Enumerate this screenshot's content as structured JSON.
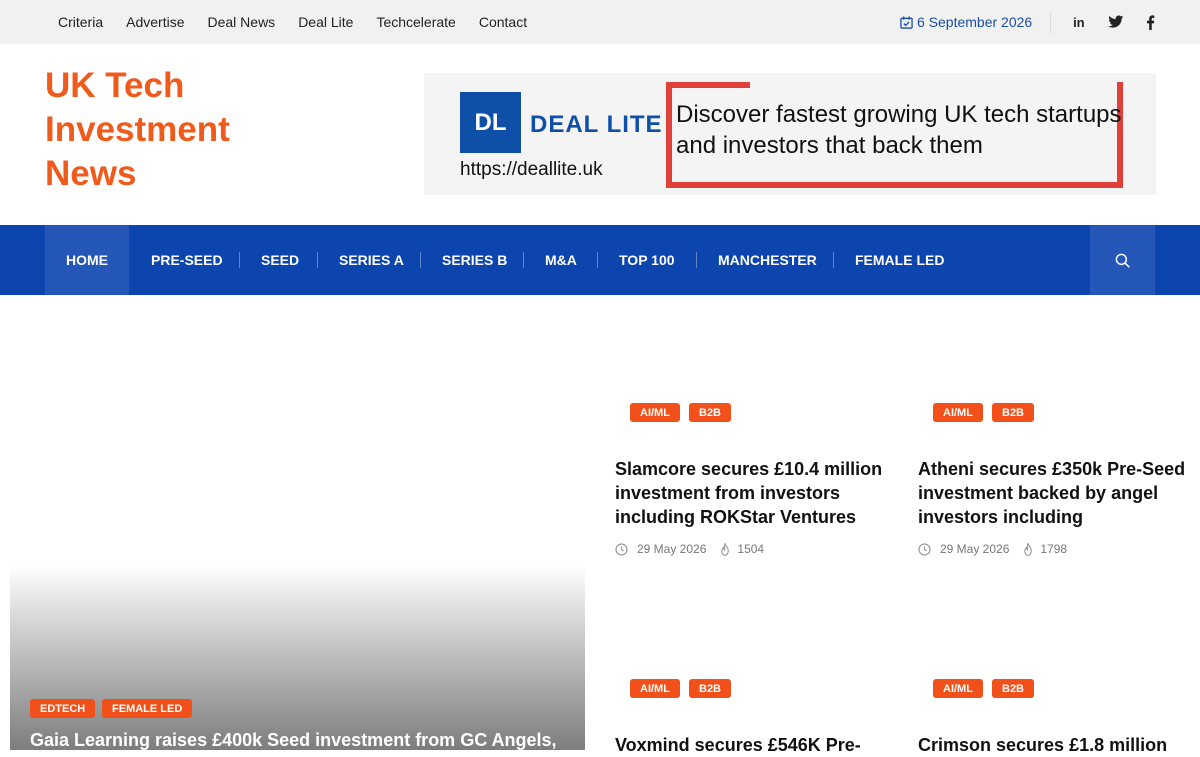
{
  "top_nav": {
    "items": [
      "Criteria",
      "Advertise",
      "Deal News",
      "Deal Lite",
      "Techcelerate",
      "Contact"
    ],
    "date": "6 September 2026",
    "social_icons": [
      "linkedin-icon",
      "twitter-icon",
      "facebook-icon"
    ]
  },
  "site": {
    "title": "UK Tech Investment News"
  },
  "banner": {
    "logo_mark": "DL",
    "logo_name": "DEAL LITE",
    "url": "https://deallite.uk",
    "tagline": "Discover fastest growing UK tech startups and investors that back them"
  },
  "main_nav": {
    "items": [
      "HOME",
      "PRE-SEED",
      "SEED",
      "SERIES A",
      "SERIES B",
      "M&A",
      "TOP 100",
      "MANCHESTER",
      "FEMALE LED"
    ],
    "active": "HOME"
  },
  "featured": {
    "tags": [
      "EDTECH",
      "FEMALE LED"
    ],
    "title": "Gaia Learning raises £400k Seed investment from GC Angels,"
  },
  "articles": [
    {
      "tags": [
        "AI/ML",
        "B2B"
      ],
      "title": "Slamcore secures £10.4 million investment from investors including ROKStar Ventures",
      "date": "29 May 2026",
      "views": "1504"
    },
    {
      "tags": [
        "AI/ML",
        "B2B"
      ],
      "title": "Atheni secures £350k Pre-Seed investment backed by angel investors including",
      "date": "29 May 2026",
      "views": "1798"
    },
    {
      "tags": [
        "AI/ML",
        "B2B"
      ],
      "title": "Voxmind secures £546K Pre-"
    },
    {
      "tags": [
        "AI/ML",
        "B2B"
      ],
      "title": "Crimson secures £1.8 million"
    }
  ],
  "colors": {
    "brand_orange": "#f05a1a",
    "nav_blue": "#0b45ad",
    "tag_orange": "#f2501a",
    "date_blue": "#1a4fa6",
    "banner_red": "#e0403a"
  }
}
